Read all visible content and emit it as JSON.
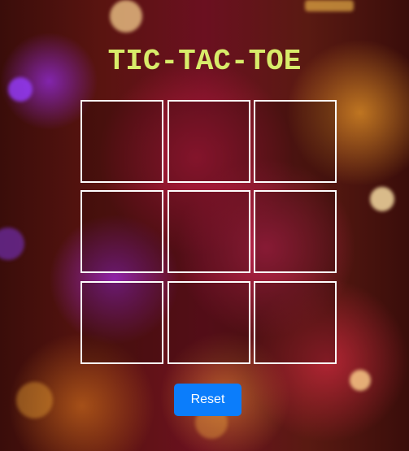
{
  "title": "TIC-TAC-TOE",
  "board": {
    "cells": [
      "",
      "",
      "",
      "",
      "",
      "",
      "",
      "",
      ""
    ]
  },
  "controls": {
    "reset_label": "Reset"
  },
  "colors": {
    "title": "#d8ec6a",
    "cell_border": "#ffffff",
    "reset_button": "#0b7dfb"
  }
}
